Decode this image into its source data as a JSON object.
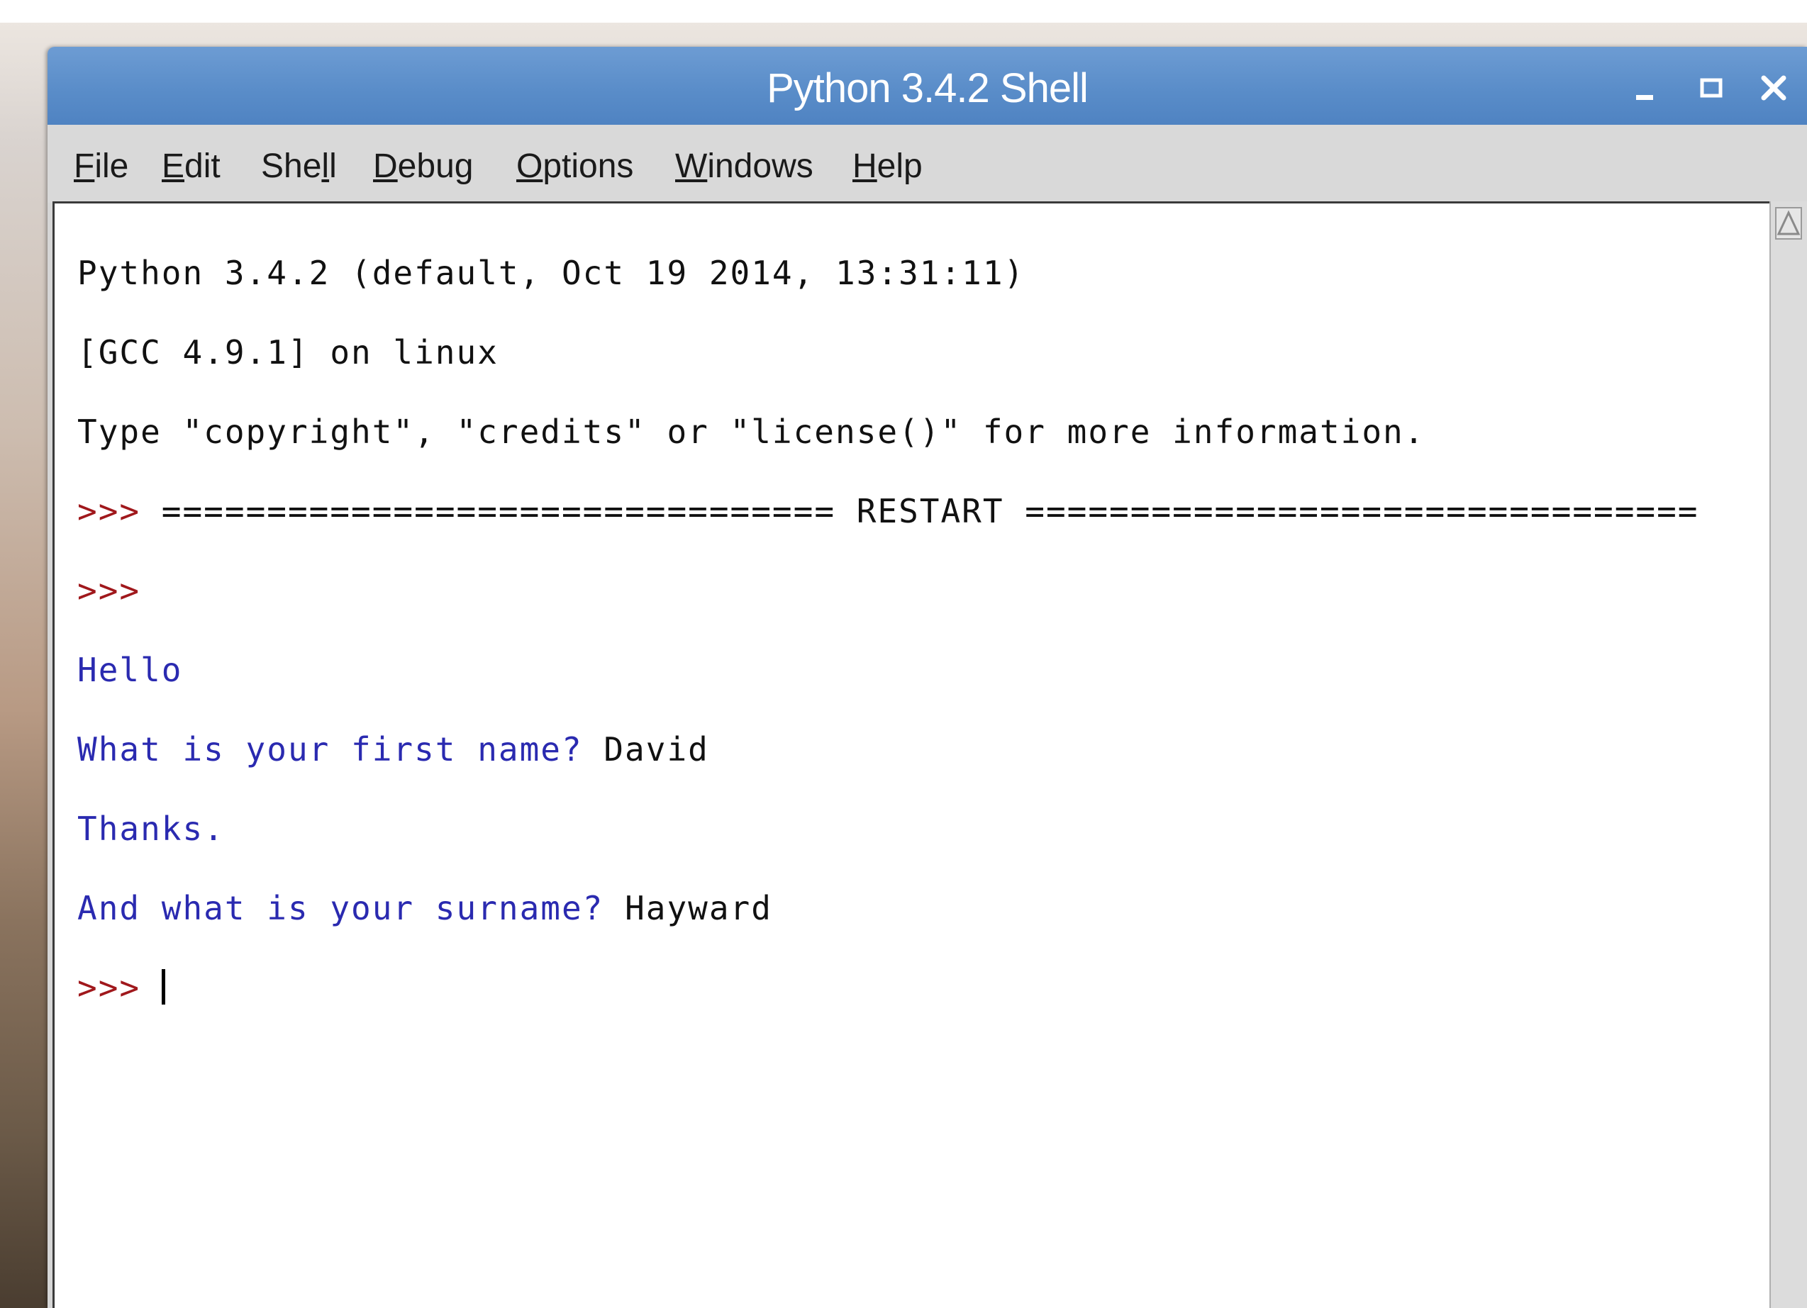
{
  "window": {
    "title": "Python 3.4.2 Shell"
  },
  "menu": {
    "items": [
      {
        "label": "File",
        "mnemonic": "F",
        "rest": "ile"
      },
      {
        "label": "Edit",
        "mnemonic": "E",
        "rest": "dit"
      },
      {
        "label": "Shell",
        "pre": "She",
        "mnemonic": "l",
        "rest": "l"
      },
      {
        "label": "Debug",
        "mnemonic": "D",
        "rest": "ebug"
      },
      {
        "label": "Options",
        "mnemonic": "O",
        "rest": "ptions"
      },
      {
        "label": "Windows",
        "mnemonic": "W",
        "rest": "indows"
      },
      {
        "label": "Help",
        "mnemonic": "H",
        "rest": "elp"
      }
    ]
  },
  "console": {
    "banner1": "Python 3.4.2 (default, Oct 19 2014, 13:31:11)",
    "banner2": "[GCC 4.9.1] on linux",
    "banner3": "Type \"copyright\", \"credits\" or \"license()\" for more information.",
    "prompt": ">>>",
    "restart": "================================ RESTART ================================",
    "out_hello": "Hello",
    "q1": "What is your first name? ",
    "a1": "David",
    "out_thanks": "Thanks.",
    "q2": "And what is your surname? ",
    "a2": "Hayward"
  },
  "colors": {
    "titlebar": "#5a8dc9",
    "prompt": "#a0181c",
    "program_output": "#2a2ab0"
  }
}
